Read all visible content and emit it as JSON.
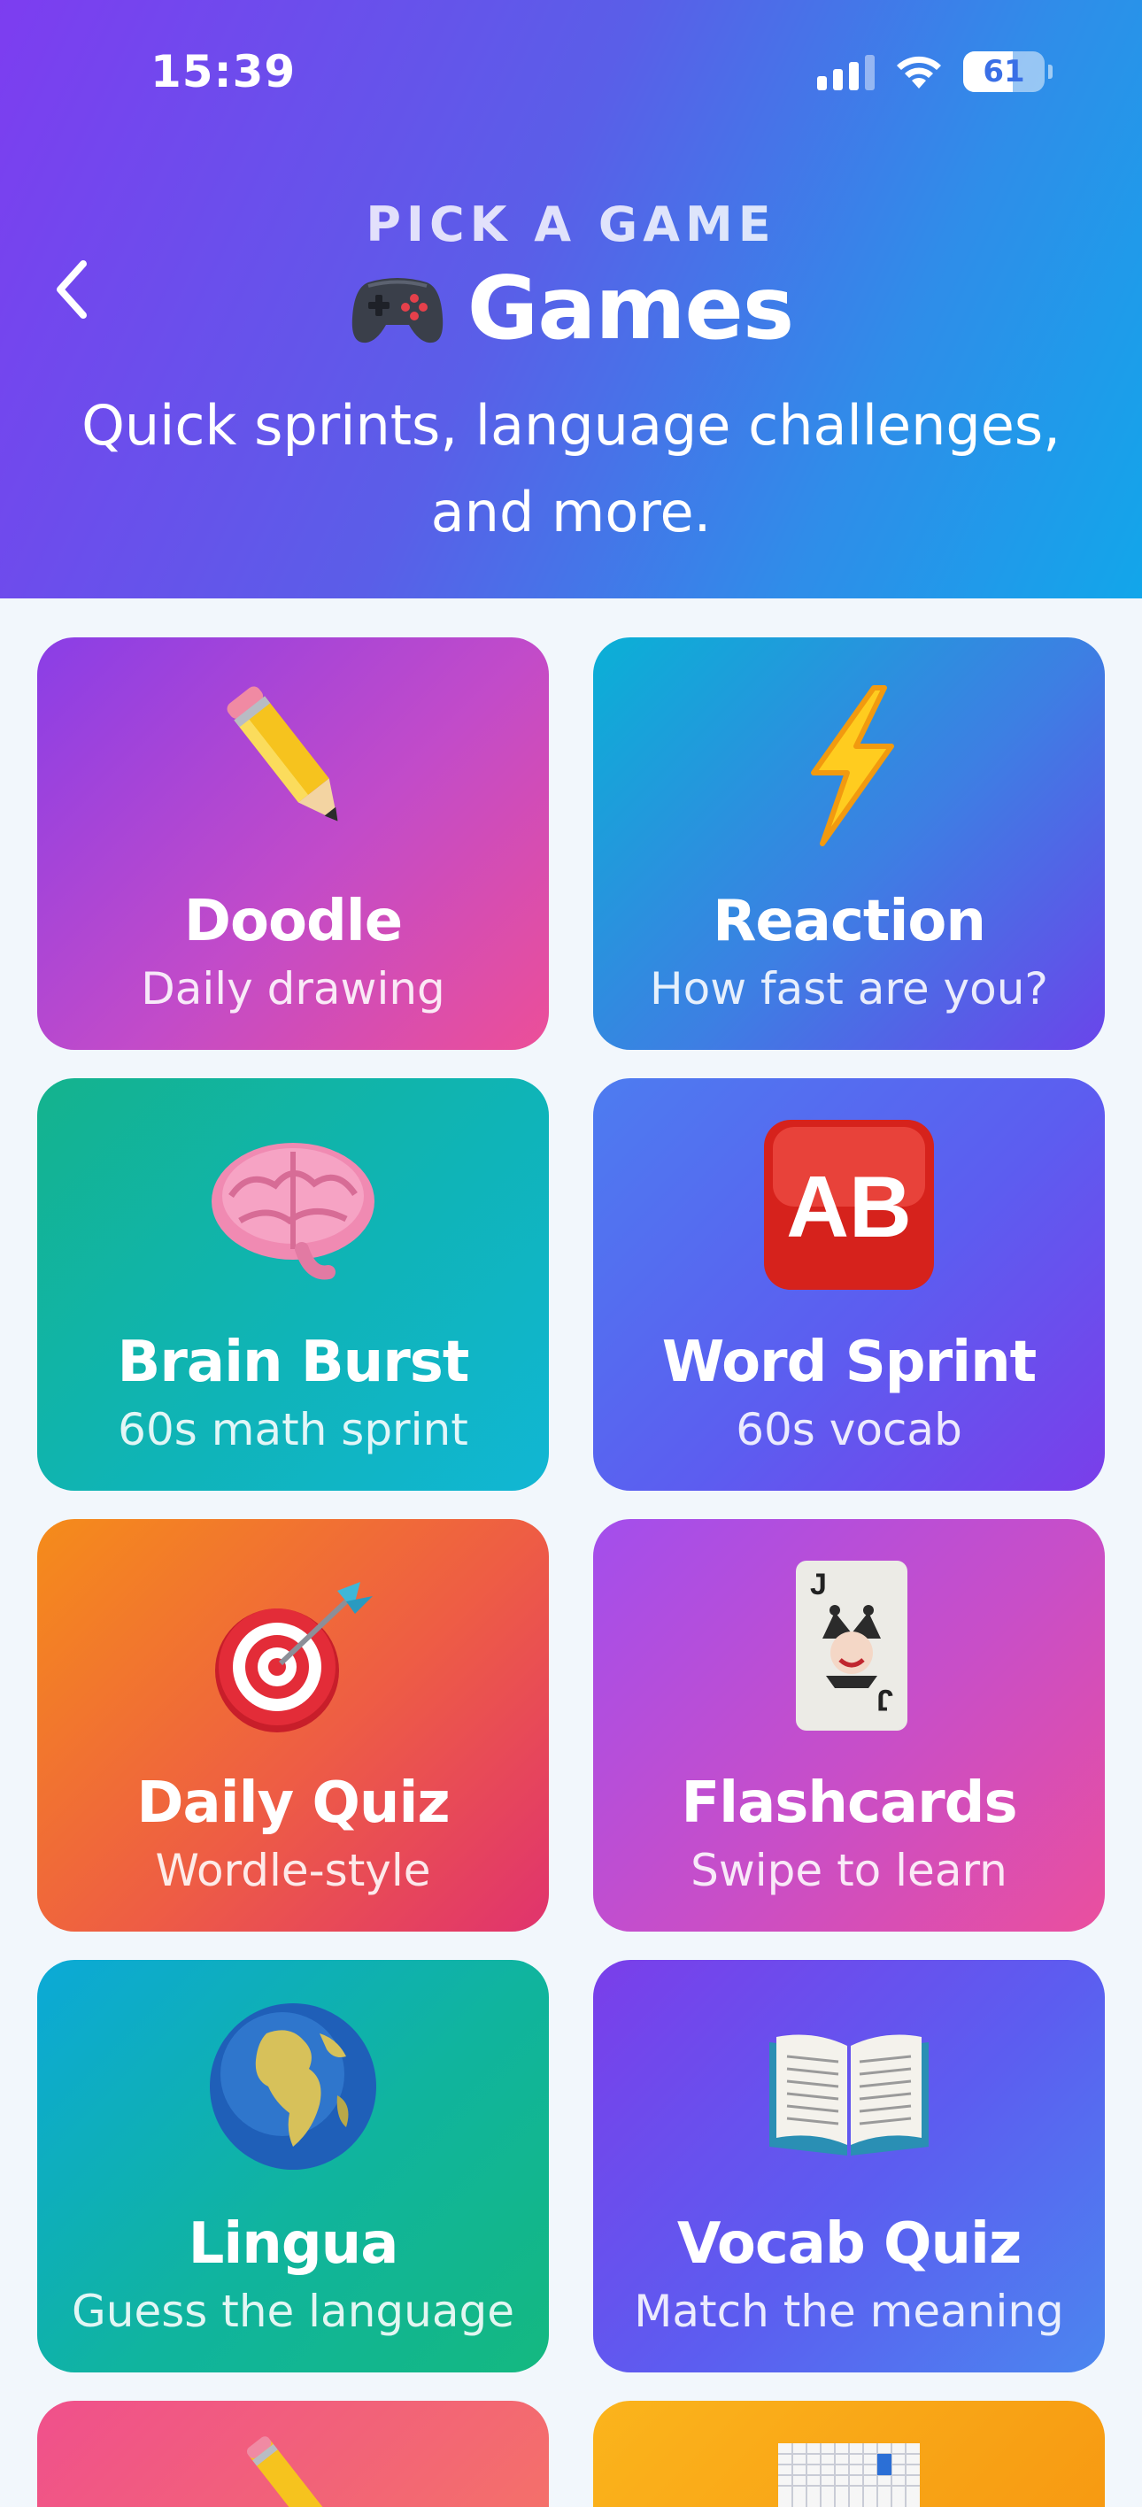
{
  "status_bar": {
    "time": "15:39",
    "battery": "61"
  },
  "header": {
    "eyebrow": "PICK A GAME",
    "title": "Games",
    "subtitle": "Quick sprints, language challenges, and more."
  },
  "games": [
    {
      "name": "Doodle",
      "description": "Daily drawing",
      "icon": "pencil-icon"
    },
    {
      "name": "Reaction",
      "description": "How fast are you?",
      "icon": "lightning-icon"
    },
    {
      "name": "Brain Burst",
      "description": "60s math sprint",
      "icon": "brain-icon"
    },
    {
      "name": "Word Sprint",
      "description": "60s vocab",
      "icon": "ab-icon"
    },
    {
      "name": "Daily Quiz",
      "description": "Wordle-style",
      "icon": "target-icon"
    },
    {
      "name": "Flashcards",
      "description": "Swipe to learn",
      "icon": "joker-card-icon"
    },
    {
      "name": "Lingua",
      "description": "Guess the language",
      "icon": "globe-icon"
    },
    {
      "name": "Vocab Quiz",
      "description": "Match the meaning",
      "icon": "open-book-icon"
    }
  ],
  "colors": {
    "header_start": "#7d3df0",
    "header_end": "#12a6ea",
    "page_background": "#f2f7fc"
  }
}
